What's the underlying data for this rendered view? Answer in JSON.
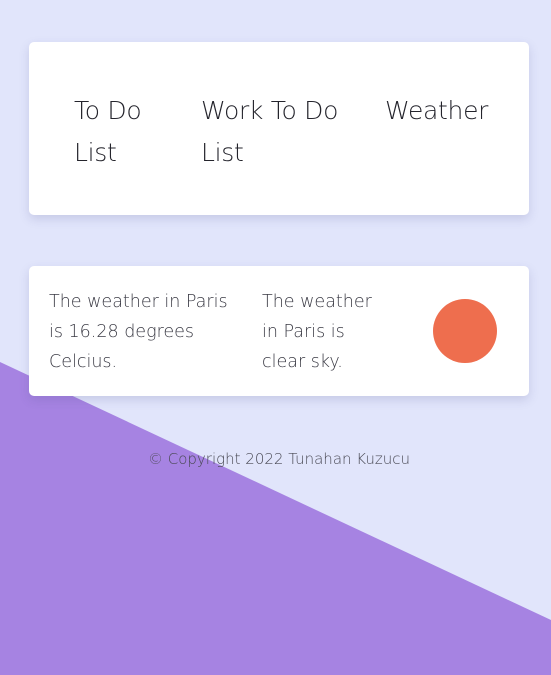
{
  "colors": {
    "background": "#e1e5fb",
    "accent_shape": "#a683e2",
    "card": "#ffffff",
    "weather_indicator": "#ee6e4e"
  },
  "nav": {
    "items": [
      {
        "label": "To Do List",
        "icon": ""
      },
      {
        "label": "Work To Do List",
        "icon": ""
      },
      {
        "label": "Weather",
        "icon": ""
      }
    ]
  },
  "weather": {
    "temperature_text": "The weather in Paris is 16.28 degrees Celcius.",
    "description_text": "The weather in Paris is clear sky.",
    "indicator_icon": "sun-icon"
  },
  "footer": {
    "copyright": "© Copyright 2022 Tunahan Kuzucu"
  }
}
